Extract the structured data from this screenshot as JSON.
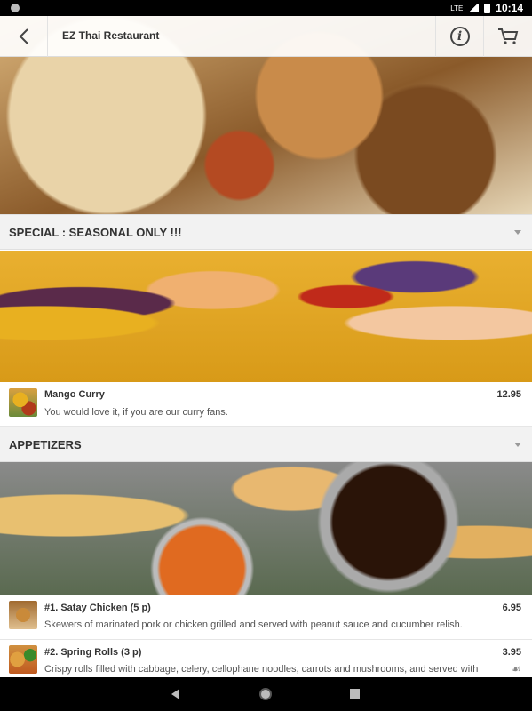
{
  "status": {
    "time": "10:14",
    "network": "LTE"
  },
  "header": {
    "title": "EZ Thai Restaurant",
    "back_icon": "chevron-left-icon",
    "info_icon": "info-icon",
    "cart_icon": "cart-icon"
  },
  "sections": [
    {
      "title": "SPECIAL : SEASONAL ONLY !!!",
      "items": [
        {
          "name": "Mango Curry",
          "description": "You would love it, if you are our curry fans.",
          "price": "12.95"
        }
      ]
    },
    {
      "title": "APPETIZERS",
      "items": [
        {
          "name": "#1. Satay Chicken (5 p)",
          "description": "Skewers of marinated pork or chicken grilled and served with peanut sauce and cucumber relish.",
          "price": "6.95"
        },
        {
          "name": "#2. Spring Rolls (3 p)",
          "description": "Crispy rolls filled with cabbage, celery, cellophane noodles, carrots and mushrooms, and served with",
          "price": "3.95",
          "badge_icon": "vegetarian-leaf-icon"
        }
      ]
    }
  ]
}
